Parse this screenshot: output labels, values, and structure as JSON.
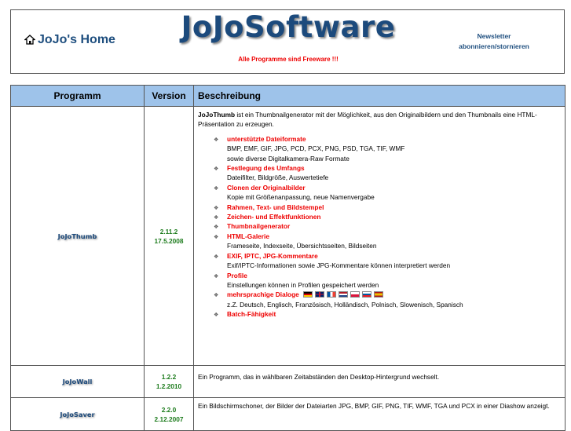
{
  "header": {
    "home_label": "JoJo's Home",
    "logo_text": "JoJoSoftware",
    "tagline": "Alle Programme sind Freeware !!!",
    "newsletter_line1": "Newsletter",
    "newsletter_line2": "abonnieren/stornieren"
  },
  "table": {
    "col_program": "Programm",
    "col_version": "Version",
    "col_description": "Beschreibung"
  },
  "programs": [
    {
      "name": "JoJoThumb",
      "version": "2.11.2",
      "date": "17.5.2008",
      "intro_bold": "JoJoThumb",
      "intro_rest": " ist ein Thumbnailgenerator mit der Möglichkeit, aus den Originalbildern und den Thumbnails eine HTML-Präsentation zu erzeugen.",
      "features": [
        {
          "title": "unterstützte Dateiformate",
          "lines": [
            "BMP, EMF, GIF, JPG, PCD, PCX, PNG, PSD, TGA, TIF, WMF",
            "sowie diverse Digitalkamera-Raw Formate"
          ]
        },
        {
          "title": "Festlegung des Umfangs",
          "lines": [
            "Dateifilter, Bildgröße, Auswertetiefe"
          ]
        },
        {
          "title": "Clonen der Originalbilder",
          "lines": [
            "Kopie mit Größenanpassung, neue Namenvergabe"
          ]
        },
        {
          "title": "Rahmen, Text- und Bildstempel",
          "lines": []
        },
        {
          "title": "Zeichen- und Effektfunktionen",
          "lines": []
        },
        {
          "title": "Thumbnailgenerator",
          "lines": []
        },
        {
          "title": "HTML-Galerie",
          "lines": [
            "Frameseite, Indexseite, Übersichtsseiten, Bildseiten"
          ]
        },
        {
          "title": "EXIF, IPTC, JPG-Kommentare",
          "lines": [
            "Exif/IPTC-Informationen sowie JPG-Kommentare können interpretiert  werden"
          ]
        },
        {
          "title": "Profile",
          "lines": [
            "Einstellungen können in Profilen gespeichert werden"
          ]
        },
        {
          "title": "mehrsprachige Dialoge",
          "lines": [
            "z.Z. Deutsch, Englisch, Französisch, Holländisch, Polnisch, Slowenisch, Spanisch"
          ]
        },
        {
          "title": "Batch-Fähigkeit",
          "lines": []
        }
      ]
    },
    {
      "name": "JoJoWall",
      "version": "1.2.2",
      "date": "1.2.2010",
      "description": "Ein Programm, das in wählbaren Zeitabständen den Desktop-Hintergrund wechselt."
    },
    {
      "name": "JoJoSaver",
      "version": "2.2.0",
      "date": "2.12.2007",
      "description": "Ein Bildschirmschoner, der Bilder der Dateiarten JPG, BMP, GIF, PNG, TIF, WMF, TGA und PCX in einer Diashow anzeigt."
    }
  ],
  "flag_icons": [
    "german-flag-icon",
    "uk-flag-icon",
    "french-flag-icon",
    "dutch-flag-icon",
    "polish-flag-icon",
    "slovenian-flag-icon",
    "spanish-flag-icon"
  ],
  "colors": {
    "brand": "#1c4a7c",
    "header_bg": "#9ec3ea",
    "feature_red": "#ee0000",
    "version_green": "#1a7a1a"
  }
}
